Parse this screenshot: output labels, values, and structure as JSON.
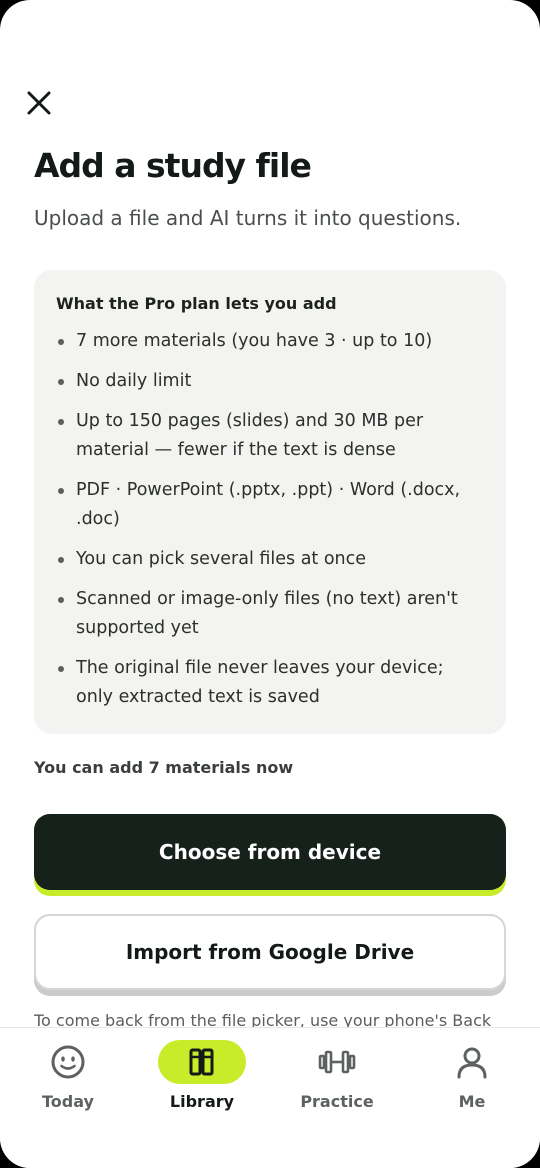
{
  "header": {
    "close_icon": "close-icon",
    "title": "Add a study file",
    "subtitle": "Upload a file and AI turns it into questions."
  },
  "pro_card": {
    "heading": "What the Pro plan lets you add",
    "items": [
      "7 more materials (you have 3 · up to 10)",
      "No daily limit",
      "Up to 150 pages (slides) and 30 MB per material — fewer if the text is dense",
      "PDF · PowerPoint (.pptx, .ppt) · Word (.docx, .doc)",
      "You can pick several files at once",
      "Scanned or image-only files (no text) aren't supported yet",
      "The original file never leaves your device; only extracted text is saved"
    ]
  },
  "status": {
    "can_add": "You can add 7 materials now"
  },
  "actions": {
    "choose_device_label": "Choose from device",
    "google_drive_label": "Import from Google Drive"
  },
  "footnote": "To come back from the file picker, use your phone's Back",
  "tabs": [
    {
      "label": "Today",
      "icon": "smiley-face-icon",
      "active": false
    },
    {
      "label": "Library",
      "icon": "books-icon",
      "active": true
    },
    {
      "label": "Practice",
      "icon": "dumbbell-icon",
      "active": false
    },
    {
      "label": "Me",
      "icon": "person-icon",
      "active": false
    }
  ],
  "colors": {
    "accent": "#c8ec2a",
    "primary_button": "#17211b",
    "card_background": "#f3f3f1"
  }
}
